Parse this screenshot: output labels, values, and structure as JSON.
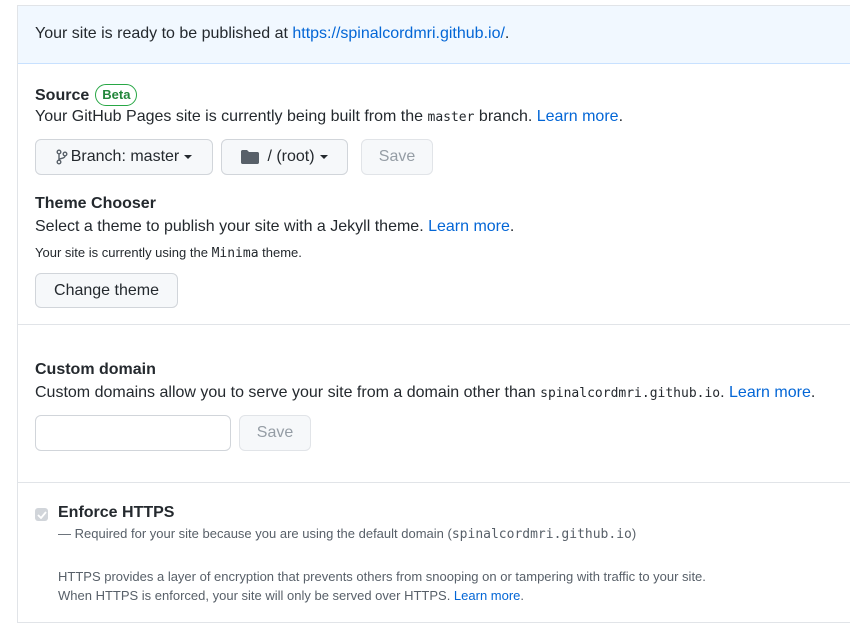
{
  "flash": {
    "text": "Your site is ready to be published at ",
    "url": "https://spinalcordmri.github.io/",
    "suffix": "."
  },
  "source": {
    "title": "Source",
    "badge": "Beta",
    "desc_pre": "Your GitHub Pages site is currently being built from the ",
    "branch_code": "master",
    "desc_post": " branch. ",
    "learn_more": "Learn more",
    "period": ".",
    "branch_button": "Branch: master",
    "folder_button": "/ (root)",
    "save_button": "Save"
  },
  "theme": {
    "title": "Theme Chooser",
    "desc": "Select a theme to publish your site with a Jekyll theme. ",
    "learn_more": "Learn more",
    "period": ".",
    "current_pre": "Your site is currently using the ",
    "current_theme": "Minima",
    "current_post": " theme.",
    "change_button": "Change theme"
  },
  "custom_domain": {
    "title": "Custom domain",
    "desc_pre": "Custom domains allow you to serve your site from a domain other than ",
    "domain_code": "spinalcordmri.github.io",
    "desc_post": ". ",
    "learn_more": "Learn more",
    "period": ".",
    "input_value": "",
    "input_placeholder": "",
    "save_button": "Save"
  },
  "https": {
    "title": "Enforce HTTPS",
    "checked": true,
    "required_pre": "— Required for your site because you are using the default domain (",
    "required_code": "spinalcordmri.github.io",
    "required_post": ")",
    "info_line1": "HTTPS provides a layer of encryption that prevents others from snooping on or tampering with traffic to your site.",
    "info_line2": "When HTTPS is enforced, your site will only be served over HTTPS. ",
    "learn_more": "Learn more",
    "period": "."
  }
}
